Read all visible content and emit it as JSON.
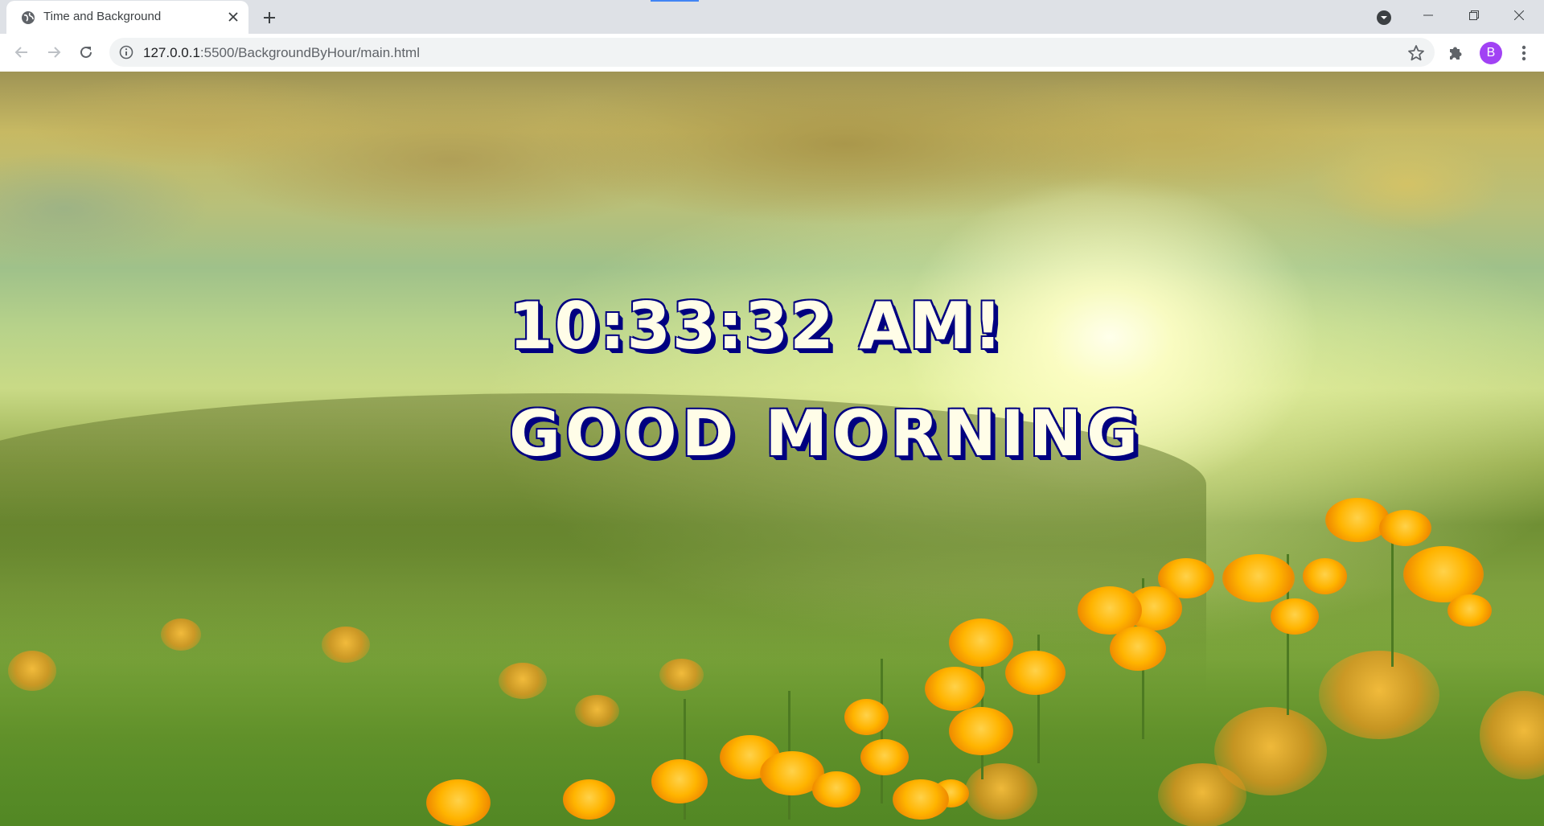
{
  "browser": {
    "tab": {
      "title": "Time and Background",
      "favicon": "globe-icon"
    },
    "address_bar": {
      "url_host": "127.0.0.1",
      "url_path": ":5500/BackgroundByHour/main.html"
    },
    "profile": {
      "initial": "B",
      "color": "#a142f4"
    },
    "icons": {
      "back": "arrow-left-icon",
      "forward": "arrow-right-icon",
      "reload": "reload-icon",
      "info": "info-icon",
      "bookmark": "star-icon",
      "extensions": "puzzle-icon",
      "menu": "kebab-menu-icon",
      "new_tab": "plus-icon",
      "tab_close": "close-icon",
      "tab_search": "chevron-down-circle-icon",
      "minimize": "minimize-icon",
      "maximize": "restore-icon",
      "window_close": "close-icon"
    }
  },
  "page": {
    "clock_text": "10:33:32 AM!",
    "greeting_text": "GOOD MORNING",
    "text_fill_color": "#fffde8",
    "text_outline_color": "#000080",
    "background": "sunny meadow with orange flowers"
  }
}
